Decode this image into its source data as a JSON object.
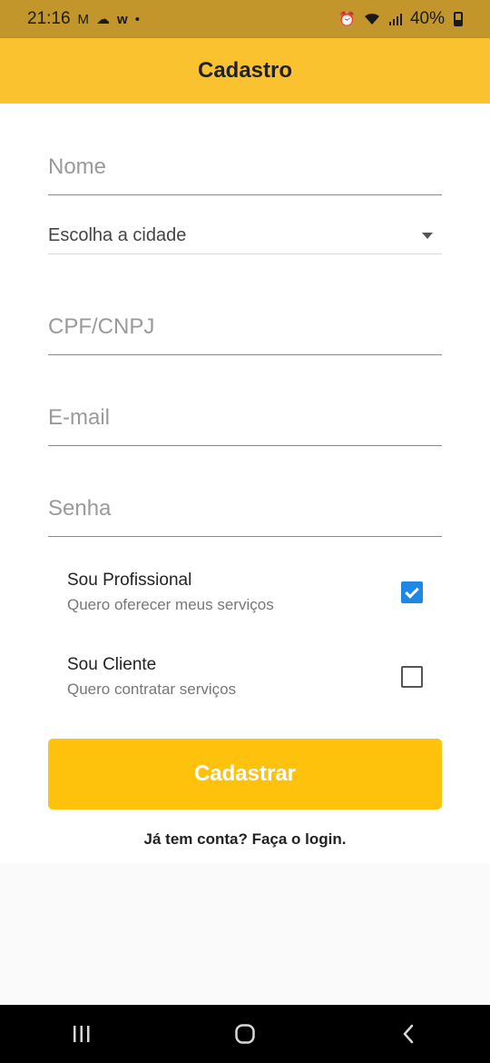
{
  "status_bar": {
    "time": "21:16",
    "battery": "40%",
    "icons_left": [
      "gmail-icon",
      "cloud-icon",
      "app-w-icon",
      "dot-icon"
    ],
    "icons_right": [
      "alarm-icon",
      "wifi-icon",
      "signal-icon",
      "battery-icon"
    ]
  },
  "app_bar": {
    "title": "Cadastro",
    "color": "#f9c22e"
  },
  "form": {
    "name": {
      "placeholder": "Nome",
      "value": ""
    },
    "city": {
      "label": "Escolha a cidade"
    },
    "document": {
      "placeholder": "CPF/CNPJ",
      "value": ""
    },
    "email": {
      "placeholder": "E-mail",
      "value": ""
    },
    "password": {
      "placeholder": "Senha",
      "value": ""
    },
    "options": [
      {
        "title": "Sou Profissional",
        "subtitle": "Quero oferecer meus serviços",
        "checked": true
      },
      {
        "title": "Sou Cliente",
        "subtitle": "Quero contratar serviços",
        "checked": false
      }
    ],
    "submit_label": "Cadastrar",
    "login_link": "Já tem conta? Faça o login."
  },
  "colors": {
    "accent": "#fec10c",
    "checkbox": "#1e88e5"
  }
}
